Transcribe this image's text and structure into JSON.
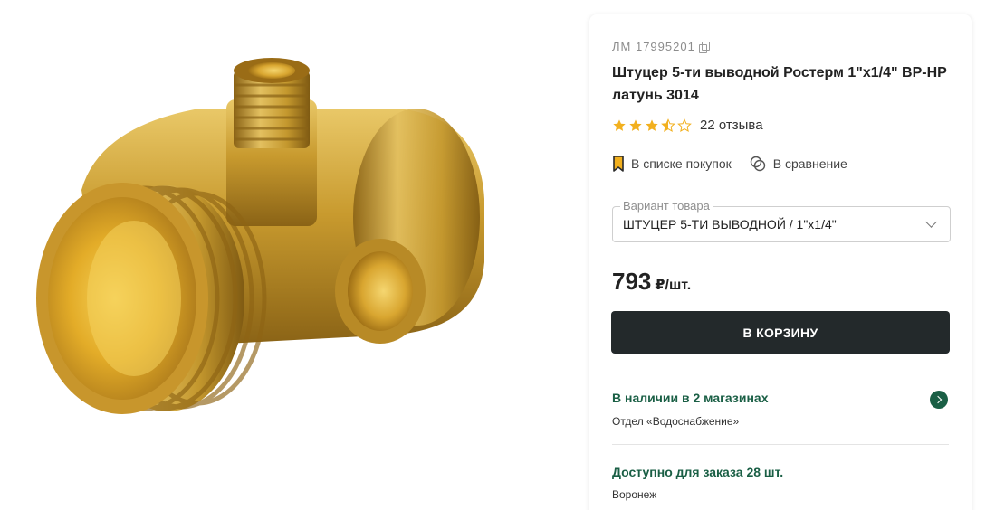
{
  "product": {
    "sku": "ЛМ 17995201",
    "title": "Штуцер 5-ти выводной Ростерм 1\"x1/4\" ВР-НР латунь 3014",
    "rating": 3.5,
    "reviews_label": "22 отзыва"
  },
  "actions": {
    "shopping_list_label": "В списке покупок",
    "compare_label": "В сравнение"
  },
  "variant": {
    "legend": "Вариант товара",
    "selected": "ШТУЦЕР 5-ТИ ВЫВОДНОЙ / 1\"x1/4\""
  },
  "price": {
    "value": "793",
    "unit": "₽/шт."
  },
  "cart": {
    "button_label": "В КОРЗИНУ"
  },
  "availability": {
    "stock_title": "В наличии в 2 магазинах",
    "department": "Отдел «Водоснабжение»",
    "order_title": "Доступно для заказа 28 шт.",
    "city": "Воронеж"
  },
  "colors": {
    "accent_green": "#1a5f45",
    "button_dark": "#23292b",
    "star_gold": "#f2b01e",
    "bookmark_yellow": "#f2b01e"
  }
}
